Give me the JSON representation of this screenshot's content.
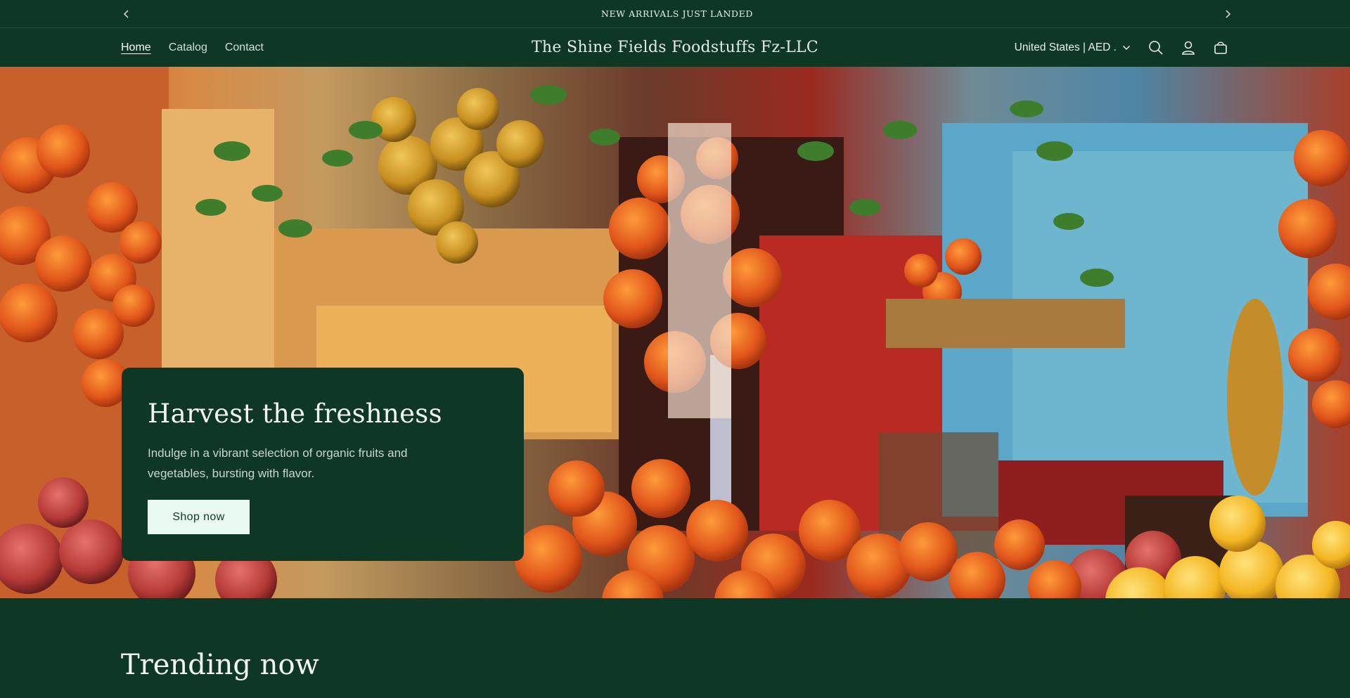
{
  "announcement": {
    "text": "NEW ARRIVALS JUST LANDED"
  },
  "nav": {
    "items": [
      "Home",
      "Catalog",
      "Contact"
    ]
  },
  "store": {
    "name": "The Shine Fields Foodstuffs Fz-LLC"
  },
  "locale": {
    "label": "United States | AED  ."
  },
  "hero": {
    "heading": "Harvest the freshness",
    "text": "Indulge in a vibrant selection of organic fruits and vegetables, bursting with flavor.",
    "button": "Shop now"
  },
  "trending": {
    "heading": "Trending now"
  },
  "colors": {
    "brand": "#0e3726",
    "button_bg": "#e9fbf0",
    "text": "#e8f1ea"
  },
  "icons": [
    "chevron-left-icon",
    "chevron-right-icon",
    "chevron-down-icon",
    "search-icon",
    "account-icon",
    "cart-icon"
  ]
}
